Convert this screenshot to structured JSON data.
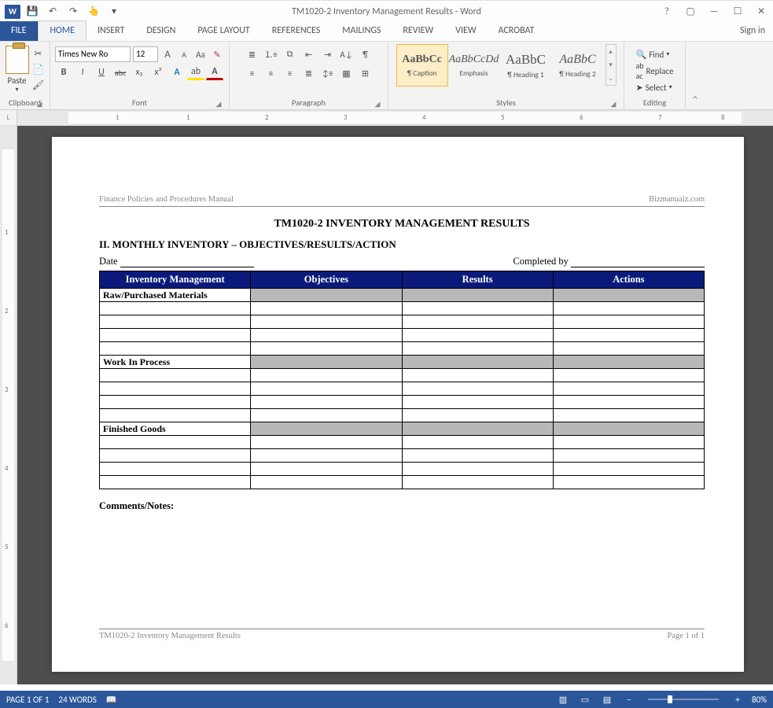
{
  "title_bar": {
    "title": "TM1020-2 Inventory Management Results - Word",
    "qat": {
      "save": "💾",
      "undo": "↶",
      "redo": "↷",
      "customize": "▾"
    },
    "help": "?",
    "sign_in": "Sign in"
  },
  "tabs": {
    "file": "FILE",
    "home": "HOME",
    "insert": "INSERT",
    "design": "DESIGN",
    "page_layout": "PAGE LAYOUT",
    "references": "REFERENCES",
    "mailings": "MAILINGS",
    "review": "REVIEW",
    "view": "VIEW",
    "acrobat": "ACROBAT"
  },
  "ribbon": {
    "clipboard": {
      "paste": "Paste",
      "label": "Clipboard"
    },
    "font": {
      "family": "Times New Ro",
      "size": "12",
      "grow": "A",
      "shrink": "A",
      "caps": "Aa",
      "clear": "ℓ",
      "bold": "B",
      "italic": "I",
      "underline": "U",
      "strike": "abc",
      "sub": "x₂",
      "sup": "x²",
      "effects": "A",
      "highlight": "ab",
      "color": "A",
      "label": "Font"
    },
    "para": {
      "label": "Paragraph"
    },
    "styles": {
      "s1": {
        "prev": "AaBbCc",
        "name": "¶ Caption"
      },
      "s2": {
        "prev": "AaBbCcDd",
        "name": "Emphasis"
      },
      "s3": {
        "prev": "AaBbC",
        "name": "¶ Heading 1"
      },
      "s4": {
        "prev": "AaBbC",
        "name": "¶ Heading 2"
      },
      "label": "Styles"
    },
    "editing": {
      "find": "Find",
      "replace": "Replace",
      "select": "Select",
      "label": "Editing"
    }
  },
  "document": {
    "hdr_left": "Finance Policies and Procedures Manual",
    "hdr_right": "Bizmanualz.com",
    "title": "TM1020-2 INVENTORY MANAGEMENT RESULTS",
    "subtitle": "II. MONTHLY INVENTORY – OBJECTIVES/RESULTS/ACTION",
    "date_label": "Date",
    "completed_label": "Completed by",
    "cols": {
      "c0": "Inventory Management",
      "c1": "Objectives",
      "c2": "Results",
      "c3": "Actions"
    },
    "subs": {
      "s0": "Raw/Purchased Materials",
      "s1": "Work In Process",
      "s2": "Finished Goods"
    },
    "comments": "Comments/Notes:",
    "ftr_left": "TM1020-2 Inventory Management Results",
    "ftr_right": "Page 1 of 1"
  },
  "status": {
    "page": "PAGE 1 OF 1",
    "words": "24 WORDS",
    "zoom": "80%"
  }
}
